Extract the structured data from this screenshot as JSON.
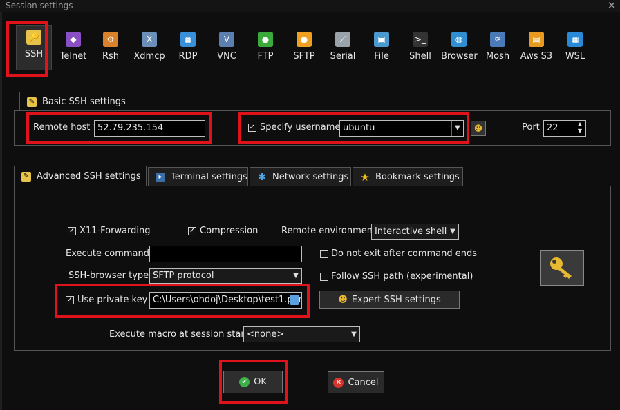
{
  "window": {
    "title": "Session settings",
    "close_glyph": "✕"
  },
  "protocols": [
    {
      "label": "SSH",
      "icon": "key-icon",
      "color": "#e8c34a",
      "glyph": "🔑",
      "selected": true
    },
    {
      "label": "Telnet",
      "icon": "telnet-icon",
      "color": "#8a4fc4",
      "glyph": "◆"
    },
    {
      "label": "Rsh",
      "icon": "rsh-icon",
      "color": "#d9822b",
      "glyph": "⚙"
    },
    {
      "label": "Xdmcp",
      "icon": "xdmcp-icon",
      "color": "#6b8fb8",
      "glyph": "X"
    },
    {
      "label": "RDP",
      "icon": "rdp-icon",
      "color": "#3a8fd9",
      "glyph": "▦"
    },
    {
      "label": "VNC",
      "icon": "vnc-icon",
      "color": "#5d7fb0",
      "glyph": "V"
    },
    {
      "label": "FTP",
      "icon": "ftp-icon",
      "color": "#3aaa3a",
      "glyph": "●"
    },
    {
      "label": "SFTP",
      "icon": "sftp-icon",
      "color": "#f0a020",
      "glyph": "●"
    },
    {
      "label": "Serial",
      "icon": "serial-icon",
      "color": "#9aa2aa",
      "glyph": "⟋"
    },
    {
      "label": "File",
      "icon": "file-icon",
      "color": "#4a9ad0",
      "glyph": "▣"
    },
    {
      "label": "Shell",
      "icon": "shell-icon",
      "color": "#333333",
      "glyph": ">_"
    },
    {
      "label": "Browser",
      "icon": "browser-icon",
      "color": "#2f8fd0",
      "glyph": "◍"
    },
    {
      "label": "Mosh",
      "icon": "mosh-icon",
      "color": "#4a7ab8",
      "glyph": "≋"
    },
    {
      "label": "Aws S3",
      "icon": "aws-s3-icon",
      "color": "#e89a20",
      "glyph": "▤"
    },
    {
      "label": "WSL",
      "icon": "wsl-icon",
      "color": "#2a8ad8",
      "glyph": "▦"
    }
  ],
  "basic": {
    "tab_label": "Basic SSH settings",
    "remote_host_label": "Remote host *",
    "remote_host_value": "52.79.235.154",
    "specify_username_label": "Specify username",
    "username_value": "ubuntu",
    "port_label": "Port",
    "port_value": "22"
  },
  "advanced_tabs": [
    {
      "label": "Advanced SSH settings",
      "icon": "key-icon",
      "active": true
    },
    {
      "label": "Terminal settings",
      "icon": "terminal-icon",
      "active": false
    },
    {
      "label": "Network settings",
      "icon": "network-icon",
      "active": false
    },
    {
      "label": "Bookmark settings",
      "icon": "star-icon",
      "active": false
    }
  ],
  "advanced": {
    "x11_label": "X11-Forwarding",
    "compression_label": "Compression",
    "remote_env_label": "Remote environment:",
    "remote_env_value": "Interactive shell",
    "exec_cmd_label": "Execute command:",
    "exec_cmd_value": "",
    "do_not_exit_label": "Do not exit after command ends",
    "ssh_browser_label": "SSH-browser type:",
    "ssh_browser_value": "SFTP protocol",
    "follow_path_label": "Follow SSH path (experimental)",
    "private_key_label": "Use private key",
    "private_key_value": "C:\\Users\\ohdoj\\Desktop\\test1.pem",
    "expert_label": "Expert SSH settings",
    "macro_label": "Execute macro at session start:",
    "macro_value": "<none>"
  },
  "buttons": {
    "ok": "OK",
    "cancel": "Cancel"
  },
  "colors": {
    "highlight_red": "#e0131c",
    "ok_green": "#3db04a",
    "cancel_red": "#d8342c",
    "key_gold": "#e8b830"
  }
}
